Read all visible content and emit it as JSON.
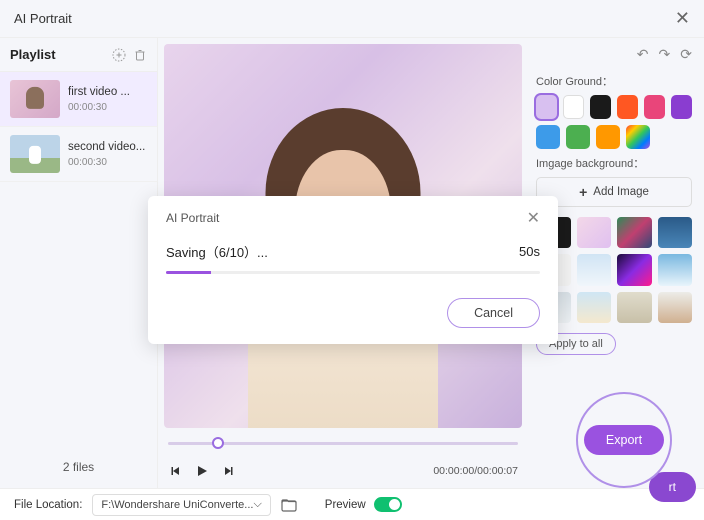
{
  "header": {
    "title": "AI Portrait"
  },
  "sidebar": {
    "title": "Playlist",
    "items": [
      {
        "title": "first video ...",
        "duration": "00:00:30"
      },
      {
        "title": "second video...",
        "duration": "00:00:30"
      }
    ],
    "file_count": "2 files"
  },
  "controls": {
    "time": "00:00:00/00:00:07"
  },
  "right": {
    "color_ground_label": "Color Ground：",
    "colors_row1": [
      "#d8c0f0",
      "#ffffff",
      "#1a1a1a",
      "#ff5722",
      "#e9457a",
      "#8a3dd0"
    ],
    "colors_row2": [
      "#3d9be9",
      "#4caf50",
      "#ff9800"
    ],
    "bg_label": "Imgage background：",
    "add_image": "Add Image",
    "backgrounds": [
      "#1a1a1a",
      "linear-gradient(135deg,#f3d8e8,#e0c0f0)",
      "linear-gradient(135deg,#2e8b57,#c04070,#304878)",
      "linear-gradient(180deg,#2a5a88,#4a86b8)",
      "#f2f2f2",
      "linear-gradient(180deg,#d0e4f4,#f0f6fb)",
      "linear-gradient(135deg,#1a0a38,#8a2be2,#ff1a8c)",
      "linear-gradient(180deg,#7ab8e0,#e8f4fb)",
      "linear-gradient(180deg,#d8e0e6,#ecf0f3)",
      "linear-gradient(180deg,#cfe6f4,#f4e8ce)",
      "linear-gradient(180deg,#e0dccc,#c8c0a8)",
      "linear-gradient(180deg,#ecece8,#d0b090)"
    ],
    "apply_all": "Apply to all",
    "export": "Export",
    "export_bg": "rt"
  },
  "footer": {
    "location_label": "File Location:",
    "path": "F:\\Wondershare UniConverte...",
    "preview_label": "Preview"
  },
  "modal": {
    "title": "AI Portrait",
    "saving": "Saving（6/10）...",
    "time": "50s",
    "cancel": "Cancel"
  }
}
